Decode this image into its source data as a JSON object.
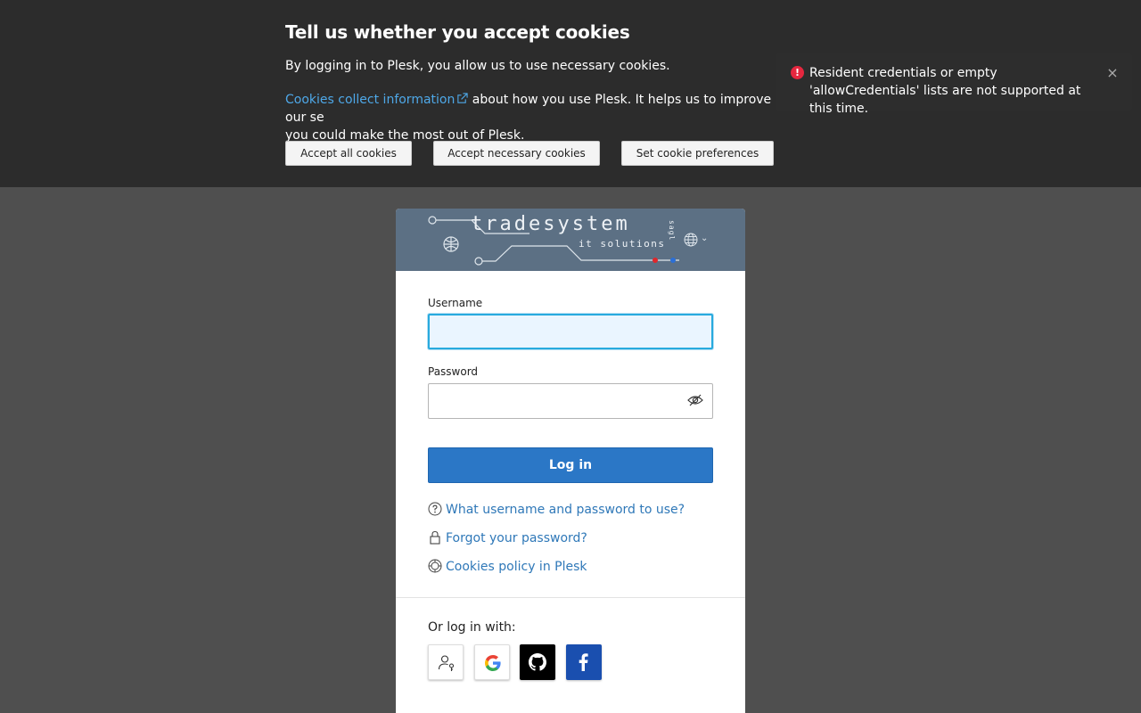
{
  "cookie_banner": {
    "title": "Tell us whether you accept cookies",
    "line1": "By logging in to Plesk, you allow us to use necessary cookies.",
    "link_text": "Cookies collect information",
    "line2_rest": " about how you use Plesk. It helps us to improve our se",
    "line2_cont": "you could make the most out of Plesk.",
    "accept_all_label": "Accept all cookies",
    "accept_necessary_label": "Accept necessary cookies",
    "preferences_label": "Set cookie preferences"
  },
  "toast": {
    "message": "Resident credentials or empty 'allowCredentials' lists are not supported at this time.",
    "close_symbol": "×",
    "status_color": "#e5273f"
  },
  "logo": {
    "wordmark": "tradesystem",
    "tagline": "it solutions",
    "vertical_text": "sagl",
    "header_color": "#5c7084"
  },
  "login": {
    "username_label": "Username",
    "username_value": "",
    "password_label": "Password",
    "password_value": "",
    "login_label": "Log in",
    "accent_color": "#2b77c6"
  },
  "links": {
    "help": "What username and password to use?",
    "forgot": "Forgot your password?",
    "cookies_policy": "Cookies policy in Plesk"
  },
  "alt_login": {
    "label": "Or log in with:",
    "providers": [
      "passkey-icon",
      "google-icon",
      "github-icon",
      "facebook-icon"
    ]
  }
}
